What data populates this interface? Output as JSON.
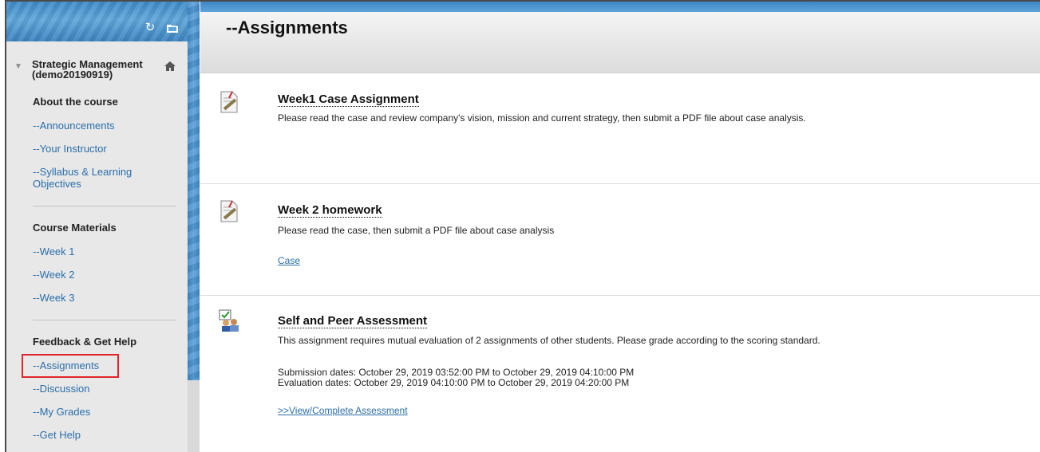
{
  "sidebar": {
    "course_title": "Strategic Management (demo20190919)",
    "sections": [
      {
        "heading": "About the course",
        "links": [
          "--Announcements",
          "--Your Instructor",
          "--Syllabus & Learning Objectives"
        ]
      },
      {
        "heading": "Course Materials",
        "links": [
          "--Week 1",
          "--Week 2",
          "--Week 3"
        ]
      },
      {
        "heading": "Feedback & Get Help",
        "links": [
          "--Assignments",
          "--Discussion",
          "--My Grades",
          "--Get Help"
        ]
      }
    ],
    "selected_link": "--Assignments",
    "icons": {
      "refresh": "refresh-icon",
      "folder": "folder-icon",
      "home": "home-icon",
      "collapse": "collapse-triangle-icon"
    }
  },
  "main": {
    "page_title": "--Assignments",
    "items": [
      {
        "title": "Week1 Case Assignment",
        "description": "Please read the case and review company's vision, mission and current strategy, then submit a PDF file about case analysis.",
        "icon": "assignment-icon"
      },
      {
        "title": "Week 2 homework",
        "description": "Please read the case, then submit a PDF file about case analysis",
        "link": "Case",
        "icon": "assignment-icon"
      },
      {
        "title": "Self and Peer Assessment",
        "description": "This assignment requires mutual evaluation of 2 assignments of other students. Please grade according to the scoring standard.",
        "submission_dates": "Submission dates: October 29, 2019 03:52:00 PM to October 29, 2019 04:10:00 PM",
        "evaluation_dates": "Evaluation dates: October 29, 2019 04:10:00 PM to October 29, 2019 04:20:00 PM",
        "link": ">>View/Complete Assessment",
        "icon": "peer-assessment-icon"
      }
    ]
  },
  "colors": {
    "accent_blue": "#3e8ac7",
    "link": "#2a6eaa",
    "highlight_red": "#e0262b",
    "sidebar_bg": "#e8e8e8"
  }
}
